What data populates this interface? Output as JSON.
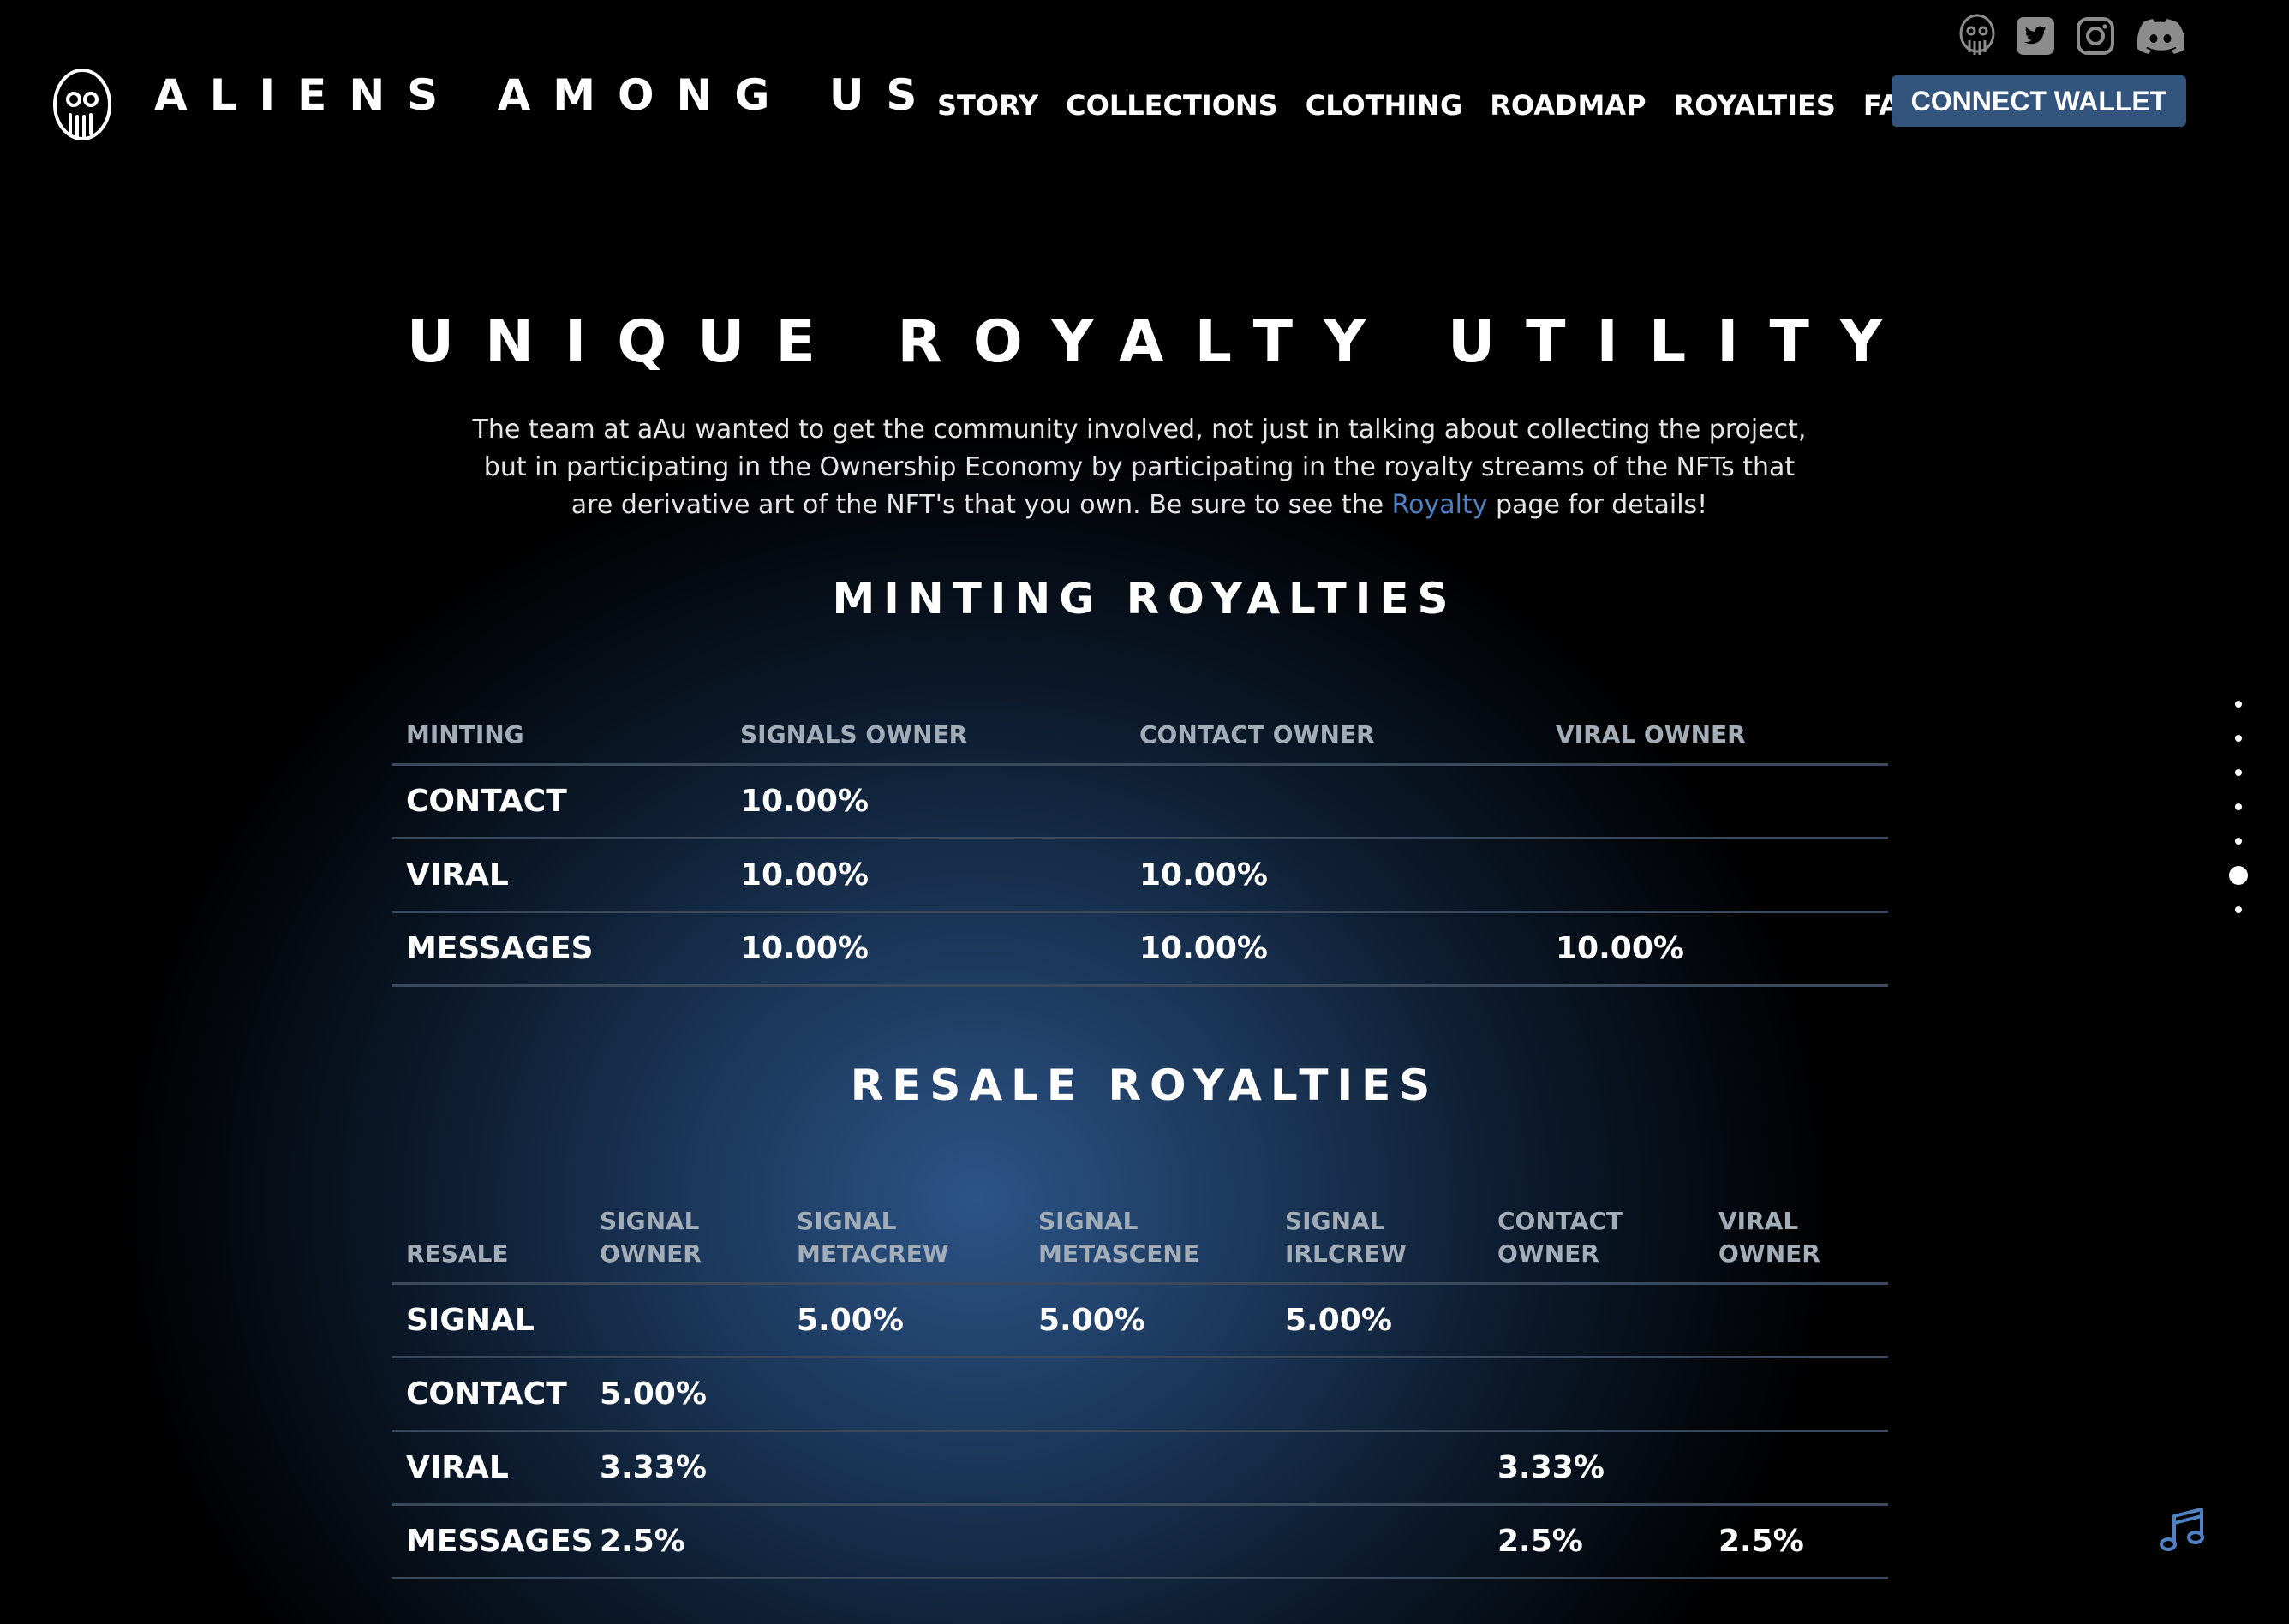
{
  "brand": {
    "name": "ALIENS AMONG US",
    "logo_icon": "alien-logo-icon"
  },
  "nav": {
    "items": [
      "STORY",
      "COLLECTIONS",
      "CLOTHING",
      "ROADMAP",
      "ROYALTIES",
      "FAQ"
    ]
  },
  "header": {
    "connect_wallet": "CONNECT WALLET"
  },
  "social": {
    "icons": [
      "alien-logo-icon",
      "twitter-icon",
      "instagram-icon",
      "discord-icon"
    ]
  },
  "section": {
    "title": "UNIQUE ROYALTY UTILITY",
    "intro_before": "The team at aAu wanted to get the community involved, not just in talking about collecting the project, but in participating in the Ownership Economy by participating in the royalty streams of the NFTs that are derivative art of the NFT's that you own. Be sure to see the ",
    "intro_link": "Royalty",
    "intro_after": " page for details!"
  },
  "minting": {
    "heading": "MINTING ROYALTIES",
    "headers": [
      "MINTING",
      "SIGNALS OWNER",
      "CONTACT OWNER",
      "VIRAL OWNER"
    ],
    "rows": [
      [
        "CONTACT",
        "10.00%",
        "",
        ""
      ],
      [
        "VIRAL",
        "10.00%",
        "10.00%",
        ""
      ],
      [
        "MESSAGES",
        "10.00%",
        "10.00%",
        "10.00%"
      ]
    ]
  },
  "resale": {
    "heading": "RESALE ROYALTIES",
    "headers": [
      "RESALE",
      "SIGNAL OWNER",
      "SIGNAL METACREW",
      "SIGNAL METASCENE",
      "SIGNAL IRLCREW",
      "CONTACT OWNER",
      "VIRAL OWNER"
    ],
    "rows": [
      [
        "SIGNAL",
        "",
        "5.00%",
        "5.00%",
        "5.00%",
        "",
        ""
      ],
      [
        "CONTACT",
        "5.00%",
        "",
        "",
        "",
        "",
        ""
      ],
      [
        "VIRAL",
        "3.33%",
        "",
        "",
        "",
        "3.33%",
        ""
      ],
      [
        "MESSAGES",
        "2.5%",
        "",
        "",
        "",
        "2.5%",
        "2.5%"
      ]
    ]
  },
  "page_nav": {
    "count": 7,
    "active_index": 5
  },
  "widgets": {
    "music_icon": "music-note-icon"
  },
  "colors": {
    "accent": "#32547d",
    "link": "#4f82c4",
    "background": "#000000"
  }
}
